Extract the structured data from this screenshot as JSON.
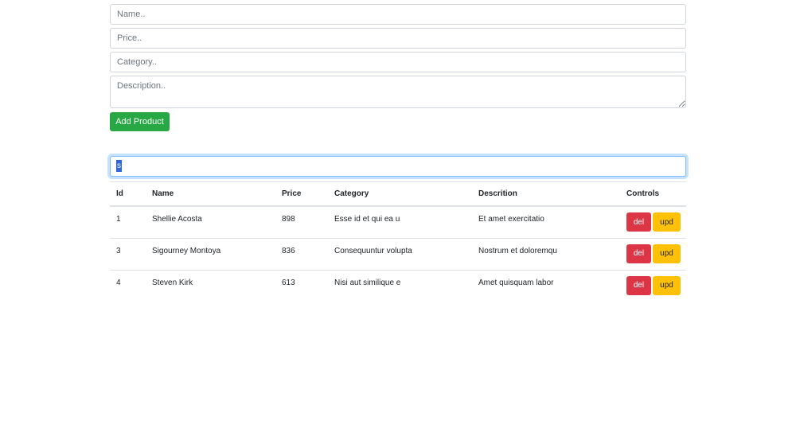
{
  "form": {
    "name_placeholder": "Name..",
    "price_placeholder": "Price..",
    "category_placeholder": "Category..",
    "description_placeholder": "Description..",
    "add_button_label": "Add Product"
  },
  "search": {
    "value": "s"
  },
  "table": {
    "headers": {
      "id": "Id",
      "name": "Name",
      "price": "Price",
      "category": "Category",
      "description": "Descrition",
      "controls": "Controls"
    },
    "rows": [
      {
        "id": "1",
        "name": "Shellie Acosta",
        "price": "898",
        "category": "Esse id et qui ea u",
        "description": "Et amet exercitatio",
        "del_label": "del",
        "upd_label": "upd"
      },
      {
        "id": "3",
        "name": "Sigourney Montoya",
        "price": "836",
        "category": "Consequuntur volupta",
        "description": "Nostrum et doloremqu",
        "del_label": "del",
        "upd_label": "upd"
      },
      {
        "id": "4",
        "name": "Steven Kirk",
        "price": "613",
        "category": "Nisi aut similique e",
        "description": "Amet quisquam labor",
        "del_label": "del",
        "upd_label": "upd"
      }
    ]
  },
  "colors": {
    "success": "#28a745",
    "danger": "#dc3545",
    "warning": "#ffc107",
    "focus_border": "#80bdff"
  }
}
